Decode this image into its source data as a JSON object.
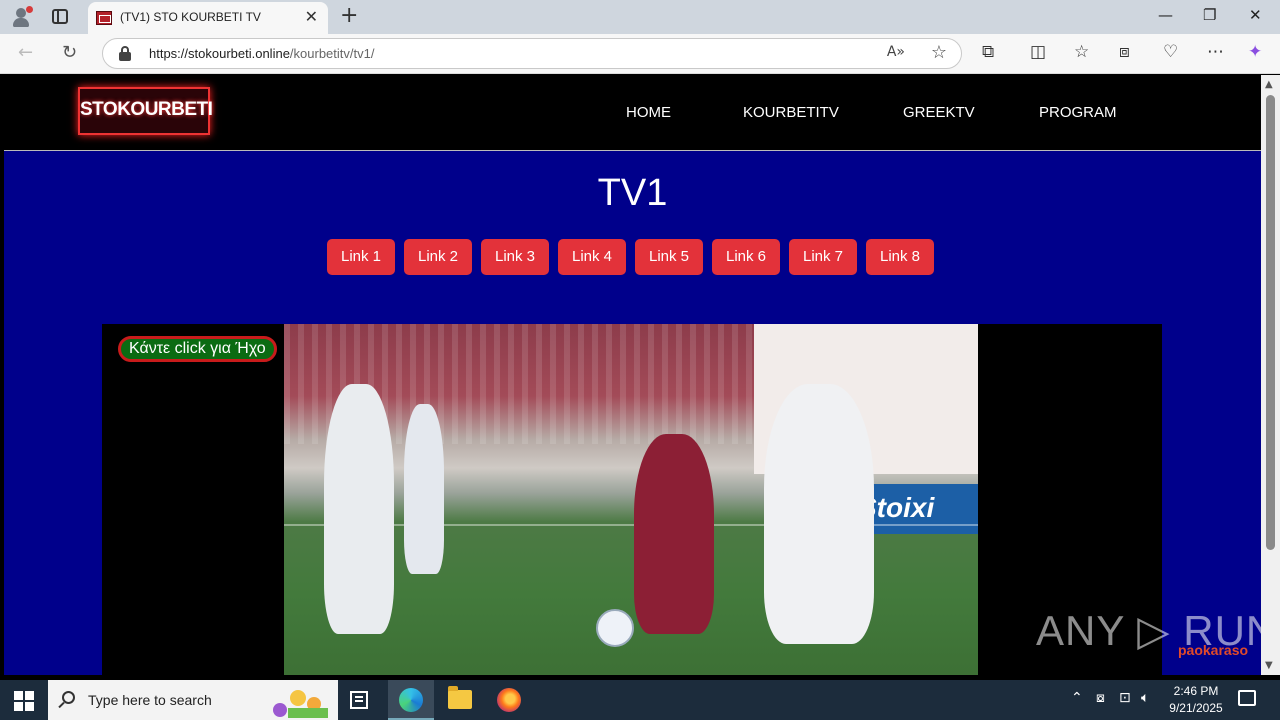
{
  "browser": {
    "tab_title": "(TV1) STO KOURBETI TV",
    "tab_close": "✕",
    "new_tab": "+",
    "url_domain": "https://stokourbeti.online",
    "url_path": "/kourbetitv/tv1/",
    "window_controls": {
      "minimize": "—",
      "restore": "❐",
      "close": "✕"
    }
  },
  "site": {
    "logo_text": "STOKOURBETI",
    "menu": [
      {
        "label": "HOME"
      },
      {
        "label": "KOURBETITV"
      },
      {
        "label": "GREEKTV"
      },
      {
        "label": "PROGRAM"
      }
    ],
    "page_title": "TV1",
    "links": [
      "Link 1",
      "Link 2",
      "Link 3",
      "Link 4",
      "Link 5",
      "Link 6",
      "Link 7",
      "Link 8"
    ],
    "sound_button": "Κάντε click για Ήχο",
    "board_text": "Stoixi",
    "overlay_text": "paokaraso"
  },
  "watermark": "ANY ▷ RUN",
  "taskbar": {
    "search_placeholder": "Type here to search",
    "time": "2:46 PM",
    "date": "9/21/2025"
  },
  "colors": {
    "page_bg": "#00008b",
    "link_button": "#e3323a",
    "sound_button_bg": "#0b6b12",
    "sound_button_border": "#c81b1b"
  }
}
